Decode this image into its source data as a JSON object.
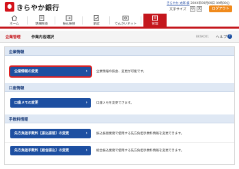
{
  "header": {
    "bank_name": "きらやか銀行",
    "user_line": "きらやか 太郎 様　20XX年09月09日 09時09分",
    "user_name": "きらやか 太郎 様",
    "timestamp": "20XX年09月09日 09時09分",
    "font_size_label": "文字サイズ",
    "font_small": "小",
    "font_large": "大",
    "logout_label": "ログアウト"
  },
  "nav": {
    "items": [
      {
        "label": "ホーム",
        "icon": "home-icon"
      },
      {
        "label": "明細照会",
        "icon": "statement-icon"
      },
      {
        "label": "振込振替",
        "icon": "transfer-icon"
      },
      {
        "label": "承認",
        "icon": "approval-icon"
      },
      {
        "label": "でんさいネット",
        "icon": "densai-icon"
      },
      {
        "label": "管理",
        "icon": "management-icon"
      }
    ],
    "active_index": 5
  },
  "titlebar": {
    "main": "企業管理",
    "sub": "作業内容選択",
    "screen_id": "BKSK001",
    "help_label": "ヘルプ",
    "help_badge": "?"
  },
  "sections": [
    {
      "title": "企業情報",
      "buttons": [
        {
          "label": "企業情報の変更",
          "desc": "企業情報の照会、変更が可能です。",
          "selected": true
        }
      ]
    },
    {
      "title": "口座情報",
      "buttons": [
        {
          "label": "口座メモの変更",
          "desc": "口座メモを変更できます。",
          "selected": false
        }
      ]
    },
    {
      "title": "手数料情報",
      "buttons": [
        {
          "label": "先方負担手数料［振込振替］の変更",
          "desc": "振込振替業務で使用する先方負担手数料情報を変更できます。",
          "selected": false
        },
        {
          "label": "先方負担手数料［総合振込］の変更",
          "desc": "総合振込業務で使用する先方負担手数料情報を変更できます。",
          "selected": false
        }
      ]
    }
  ],
  "colors": {
    "brand_red": "#c4161c",
    "button_blue": "#1d4fa1",
    "section_bg": "#dfe8f4",
    "logout_orange": "#f08a1c"
  }
}
